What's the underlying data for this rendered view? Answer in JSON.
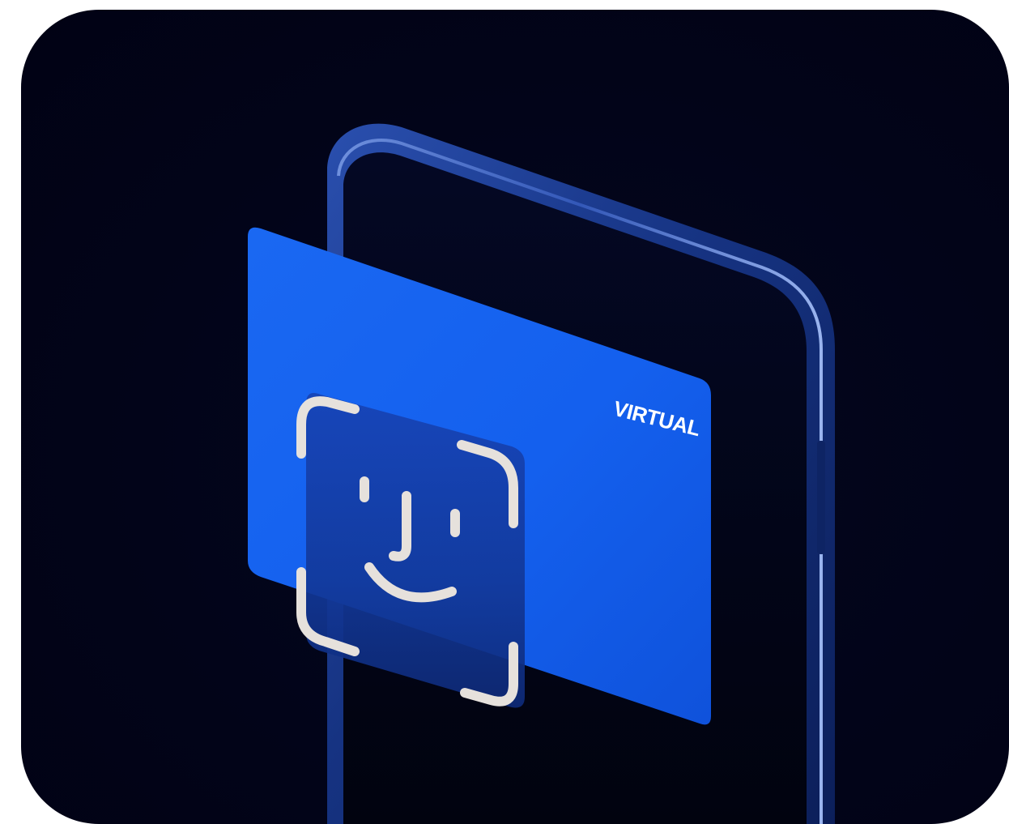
{
  "card": {
    "label": "VIRTUAL"
  },
  "icons": {
    "phone": "smartphone-icon",
    "face_id": "face-id-icon"
  },
  "colors": {
    "background": "#020419",
    "phone_frame": "#1b3a8c",
    "phone_screen": "#020516",
    "card": "#1565f0",
    "face_tile": "#123aa8",
    "face_glyph": "#e6e1dc"
  }
}
